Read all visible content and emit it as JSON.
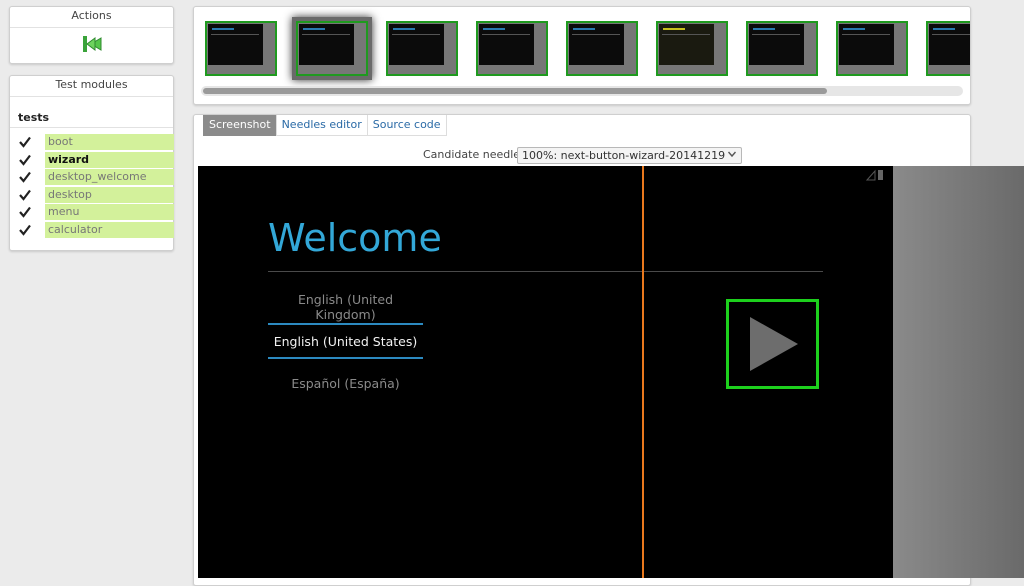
{
  "actions": {
    "title": "Actions",
    "back_icon": "back-to-start-icon"
  },
  "modules": {
    "title": "Test modules",
    "group": "tests",
    "items": [
      {
        "label": "boot",
        "current": false
      },
      {
        "label": "wizard",
        "current": true
      },
      {
        "label": "desktop_welcome",
        "current": false
      },
      {
        "label": "desktop",
        "current": false
      },
      {
        "label": "menu",
        "current": false
      },
      {
        "label": "calculator",
        "current": false
      }
    ]
  },
  "thumbnails": {
    "count": 9,
    "selected_index": 1
  },
  "viewer": {
    "tabs": [
      "Screenshot",
      "Needles editor",
      "Source code"
    ],
    "active_tab": "Screenshot",
    "candidate_label": "Candidate needle:",
    "candidate_value": "100%: next-button-wizard-20141219"
  },
  "screen": {
    "title": "Welcome",
    "languages": [
      "English (United Kingdom)",
      "English (United States)",
      "Español (España)"
    ],
    "selected_language": "English (United States)",
    "next_icon": "play-arrow-icon"
  },
  "colors": {
    "match_green": "#1dd01d",
    "module_ok": "#d3f19b",
    "welcome_blue": "#33a8d8",
    "divider_orange": "#e8781d"
  }
}
